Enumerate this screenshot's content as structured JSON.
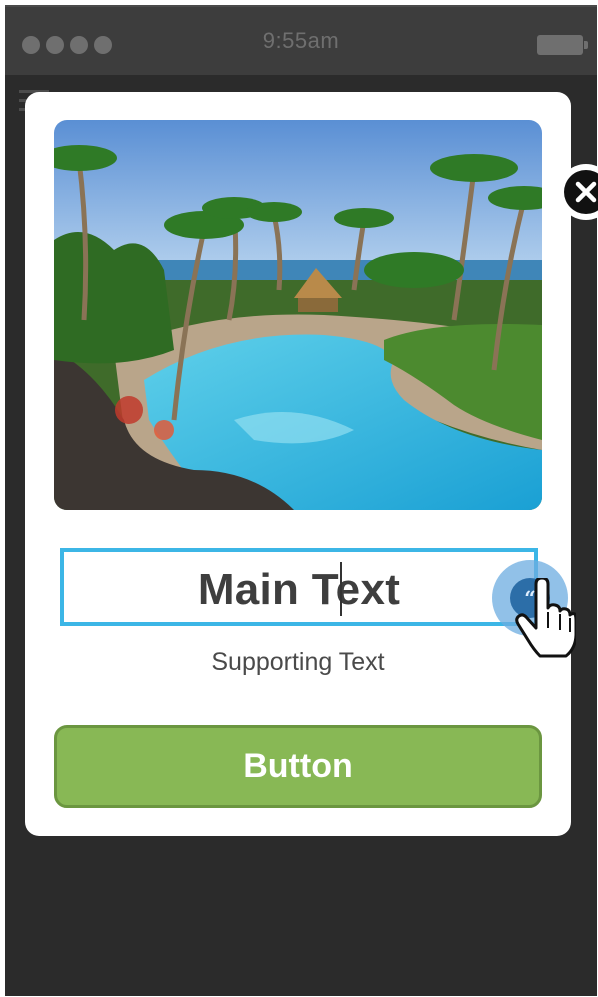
{
  "status_bar": {
    "time": "9:55am",
    "signal_icon": "signal-dots-icon",
    "battery_icon": "battery-icon"
  },
  "background": {
    "menu_icon": "hamburger-menu-icon"
  },
  "modal": {
    "close_icon": "close-icon",
    "image_description_icon": "resort-pool-photo",
    "main_text": "Main Text",
    "edit_handle_glyph": "“",
    "supporting_text": "Supporting Text",
    "button_label": "Button"
  },
  "colors": {
    "selection_border": "#3cb6e6",
    "button_fill": "#88b855",
    "phone_background": "#2b2b2b"
  }
}
